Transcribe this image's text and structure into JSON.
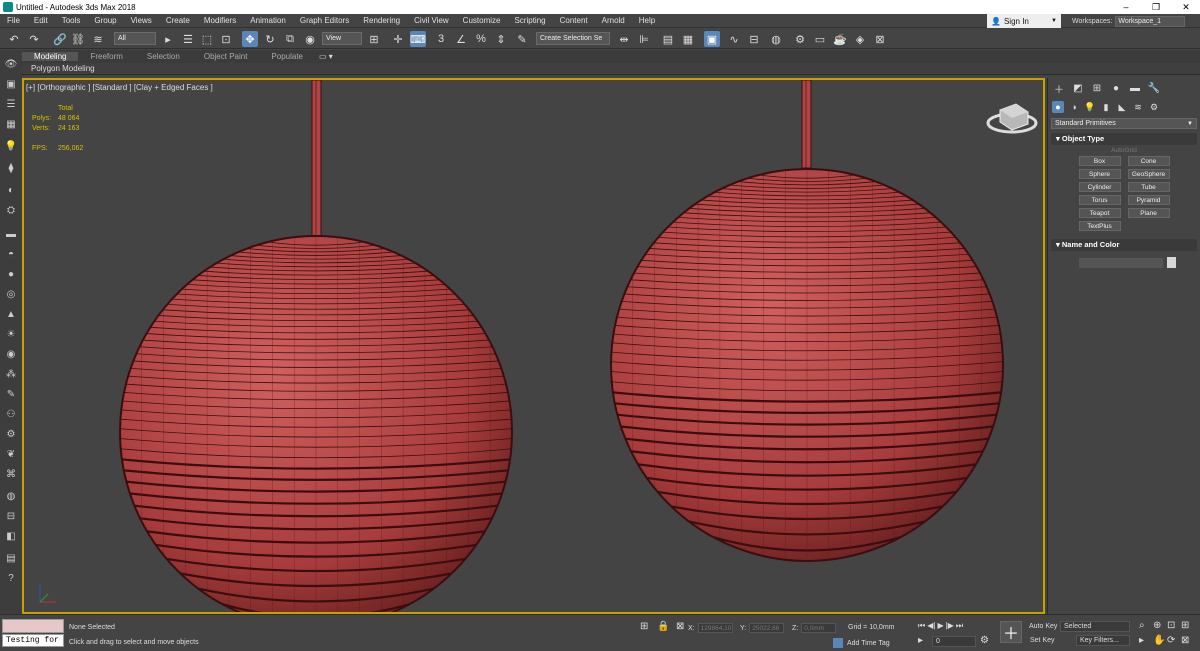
{
  "title": "Untitled - Autodesk 3ds Max 2018",
  "window_controls": {
    "minimize": "–",
    "maximize": "❐",
    "close": "✕"
  },
  "menu": [
    "File",
    "Edit",
    "Tools",
    "Group",
    "Views",
    "Create",
    "Modifiers",
    "Animation",
    "Graph Editors",
    "Rendering",
    "Civil View",
    "Customize",
    "Scripting",
    "Content",
    "Arnold",
    "Help"
  ],
  "signin": "Sign In",
  "workspaces": {
    "label": "Workspaces:",
    "value": "Workspace_1"
  },
  "toolbar": {
    "filter": "All",
    "refcoord": "View",
    "selection_set": "Create Selection Se"
  },
  "ribbon_tabs": [
    "Modeling",
    "Freeform",
    "Selection",
    "Object Paint",
    "Populate"
  ],
  "subribbon": "Polygon Modeling",
  "viewport": {
    "label": "[+] [Orthographic ] [Standard ] [Clay + Edged Faces ]",
    "stats": {
      "header": "Total",
      "polys_label": "Polys:",
      "polys": "48 064",
      "verts_label": "Verts:",
      "verts": "24 163",
      "fps_label": "FPS:",
      "fps": "256,062"
    },
    "object_color": "#b84848"
  },
  "cmdpanel": {
    "category": "Standard Primitives",
    "object_type": {
      "title": "Object Type",
      "autogrid": "AutoGrid",
      "buttons": [
        "Box",
        "Cone",
        "Sphere",
        "GeoSphere",
        "Cylinder",
        "Tube",
        "Torus",
        "Pyramid",
        "Teapot",
        "Plane",
        "TextPlus"
      ]
    },
    "name_color": {
      "title": "Name and Color"
    }
  },
  "status": {
    "maxscript_input": "Testing for s",
    "selected": "None Selected",
    "prompt": "Click and drag to select and move objects",
    "x_label": "X:",
    "x": "129864,10",
    "y_label": "Y:",
    "y": "25022,86",
    "z_label": "Z:",
    "z": "0,0mm",
    "grid": "Grid = 10,0mm",
    "add_time_tag": "Add Time Tag",
    "frame": "0",
    "autokey": "Auto Key",
    "setkey": "Set Key",
    "selected_dd": "Selected",
    "keyfilters": "Key Filters..."
  }
}
